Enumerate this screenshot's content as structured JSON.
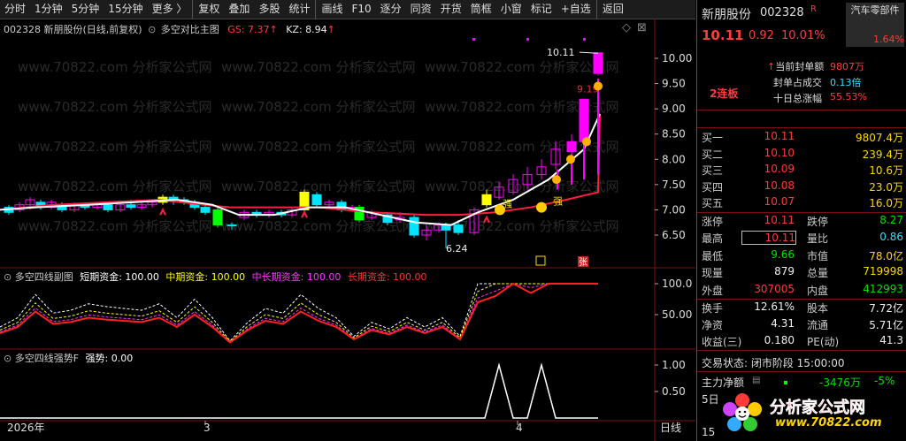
{
  "toolbar": {
    "items": [
      "分时",
      "1分钟",
      "5分钟",
      "15分钟",
      "更多 〉",
      "复权",
      "叠加",
      "多股",
      "统计",
      "画线",
      "F10",
      "逐分",
      "同资",
      "开货",
      "筒框",
      "小窗",
      "标记",
      "+自选",
      "返回"
    ]
  },
  "chart": {
    "header": {
      "stock": "002328 新朋股份(日线,前复权)",
      "indicator": "多空对比主图",
      "gs_label": "GS: 7.37",
      "kz_label": "KZ: 8.94",
      "arrow": "↑"
    },
    "price_axis": [
      "10.00",
      "9.50",
      "9.00",
      "8.50",
      "8.00",
      "7.50",
      "7.00",
      "6.50"
    ],
    "annotations": {
      "high": "10.11",
      "low": "6.24",
      "mark919": "9.19",
      "strong1": "强",
      "strong2": "强",
      "zhang": "张"
    },
    "sub1": {
      "title": "多空四线副图",
      "short": "短期资金: 100.00",
      "mid": "中期资金: 100.00",
      "midlong": "中长期资金: 100.00",
      "long": "长期资金: 100.00",
      "axis": [
        "100.0",
        "50.00"
      ]
    },
    "sub2": {
      "title": "多空四线强势F",
      "strength": "强势: 0.00",
      "axis": [
        "1.00",
        "0.50"
      ]
    },
    "xaxis": {
      "year": "2026年",
      "m3": "3",
      "m4": "4",
      "period": "日线"
    },
    "watermark": "www.70822.com 分析家公式网",
    "colors": {
      "up": "#ff00ff",
      "down": "#00e5ff",
      "up_solid_yellow": "#ffff00",
      "green": "#00ff00",
      "ma_red": "#ff1f3f",
      "ma_white": "#ffffff"
    }
  },
  "panel": {
    "name": "新朋股份",
    "code": "002328",
    "r_badge": "R",
    "sector": "汽车零部件",
    "price": "10.11",
    "change": "0.92",
    "pct": "10.01%",
    "sector_pct": "1.64%",
    "seal_label": "当前封单额",
    "seal_val": "9807万",
    "ratio_label": "封单占成交",
    "ratio_val": "0.13倍",
    "ten_label": "十日总涨幅",
    "ten_val": "55.53%",
    "lianban": "2连板",
    "bids": [
      {
        "label": "买一",
        "price": "10.11",
        "vol": "9807.4万"
      },
      {
        "label": "买二",
        "price": "10.10",
        "vol": "239.4万"
      },
      {
        "label": "买三",
        "price": "10.09",
        "vol": "10.6万"
      },
      {
        "label": "买四",
        "price": "10.08",
        "vol": "23.0万"
      },
      {
        "label": "买五",
        "price": "10.07",
        "vol": "16.0万"
      }
    ],
    "stats": [
      {
        "l1": "涨停",
        "v1": "10.11",
        "l2": "跌停",
        "v2": "8.27"
      },
      {
        "l1": "最高",
        "v1": "10.11",
        "l2": "量比",
        "v2": "0.86"
      },
      {
        "l1": "最低",
        "v1": "9.66",
        "l2": "市值",
        "v2": "78.0亿"
      },
      {
        "l1": "现量",
        "v1": "879",
        "l2": "总量",
        "v2": "719998"
      },
      {
        "l1": "外盘",
        "v1": "307005",
        "l2": "内盘",
        "v2": "412993"
      }
    ],
    "stats2": [
      {
        "l1": "换手",
        "v1": "12.61%",
        "l2": "股本",
        "v2": "7.72亿"
      },
      {
        "l1": "净资",
        "v1": "4.31",
        "l2": "流通",
        "v2": "5.71亿"
      },
      {
        "l1": "收益(三)",
        "v1": "0.180",
        "l2": "PE(动)",
        "v2": "41.3"
      }
    ],
    "trade_status": "交易状态: 闭市阶段 15:00:00",
    "main_flow_label": "主力净额",
    "main_flow_val": "-3476万",
    "main_flow_pct": "-5%",
    "day5": "5日",
    "t15": "15",
    "logo_text": "分析家公式网",
    "logo_url": "www.70822.com"
  }
}
